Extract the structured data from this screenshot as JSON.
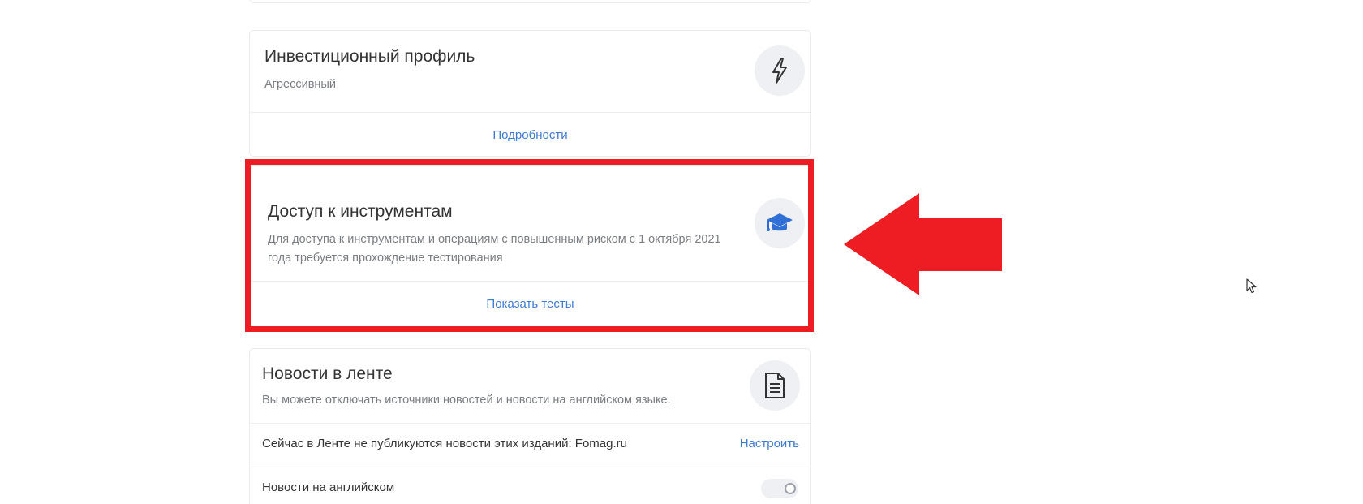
{
  "investment_profile": {
    "title": "Инвестиционный профиль",
    "subtitle": "Агрессивный",
    "icon": "lightning-icon",
    "link": "Подробности"
  },
  "tools_access": {
    "title": "Доступ к инструментам",
    "description": "Для доступа к инструментам и операциям с повышенным риском с 1 октября 2021 года требуется прохождение тестирования",
    "icon": "graduation-cap-icon",
    "link": "Показать тесты"
  },
  "news_feed": {
    "title": "Новости в ленте",
    "subtitle": "Вы можете отключать источники новостей и новости на английском языке.",
    "icon": "document-icon",
    "sources_row": "Сейчас в Ленте не публикуются новости этих изданий: Fomag.ru",
    "configure_link": "Настроить",
    "english_row": "Новости на английском"
  },
  "colors": {
    "accent_link": "#3f7ad1",
    "highlight_red": "#ee1d23",
    "cap_icon_blue": "#2f6fd6"
  }
}
